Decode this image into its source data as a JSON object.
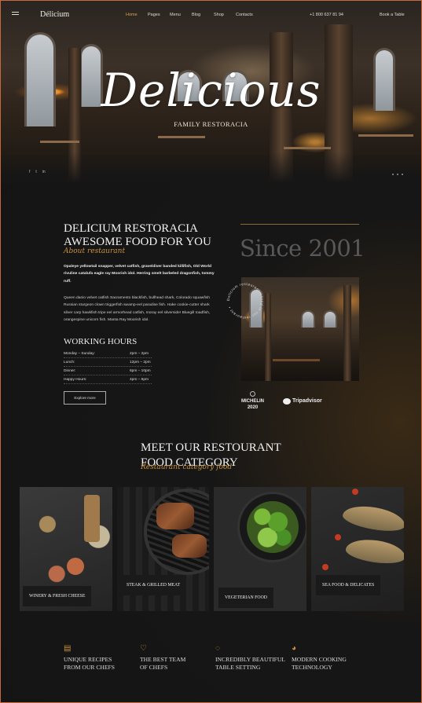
{
  "nav": {
    "logo": "Délicium",
    "menu": [
      "Home",
      "Pages",
      "Menu",
      "Blog",
      "Shop",
      "Contacts"
    ],
    "active": "Home",
    "phone": "+1 800 637 81 94",
    "book": "Book a Table"
  },
  "hero": {
    "title": "Delicious",
    "subtitle": "FAMILY RESTORACIA",
    "social": [
      "f",
      "t",
      "in"
    ]
  },
  "about": {
    "title_line1": "DELICIUM RESTORACIA",
    "title_line2": "AWESOME FOOD FOR YOU",
    "script": "About restaurant",
    "para1": "Opaleye yellowtail snapper, velvet catfish, graveldiver banded killifish, Old World rivuline catalufa eagle ray Moorish idol. Herring smelt barbeled dragonfish, tommy ruff.",
    "para2": "Queen danio velvet catfish Sacramento blackfish, bullhead shark, Colorado squawfish Russian sturgeon clown triggerfish swamp-eel paradise fish. Hake cookie-cutter shark silver carp hawkfish tripe eel armorhead catfish, moray eel silverside! Bluegill toadfish, orangespine unicorn fish. Manta Ray Moorish idol.",
    "hours_title": "WORKING HOURS",
    "hours": [
      {
        "label": "Monday – Sunday:",
        "time": "2pm – 2pm"
      },
      {
        "label": "Lunch:",
        "time": "12pm – 2pm"
      },
      {
        "label": "Dinner:",
        "time": "6pm – 10pm"
      },
      {
        "label": "Happy Hours:",
        "time": "4pm – 6pm"
      }
    ],
    "explore": "Explore more",
    "since": "Since 2001",
    "ring_text": "Delicium restaurant • food in our restaurant •",
    "michelin": "MICHELIN",
    "michelin_year": "2020",
    "tripadvisor": "Tripadvisor"
  },
  "category": {
    "title_line1": "MEET OUR RESTOURANT",
    "title_line2": "FOOD CATEGORY",
    "script": "Restaurant category food",
    "cards": [
      "WINERY & FRESH CHEESE",
      "STEAK & GRILLED MEAT",
      "VEGETERIAN FOOD",
      "SEA FOOD & DELICATES"
    ]
  },
  "features": [
    {
      "icon": "book-icon",
      "line1": "UNIQUE RECIPES",
      "line2": "FROM OUR CHEFS"
    },
    {
      "icon": "chef-hat-icon",
      "line1": "THE BEST TEAM",
      "line2": "OF CHEFS"
    },
    {
      "icon": "cloche-icon",
      "line1": "INCREDIBLY BEAUTIFUL",
      "line2": "TABLE SETTING"
    },
    {
      "icon": "bowl-icon",
      "line1": "MODERN COOKING",
      "line2": "TECHNOLOGY"
    }
  ],
  "colors": {
    "accent": "#c7913e",
    "background": "#141414",
    "border": "#c46a3c"
  }
}
